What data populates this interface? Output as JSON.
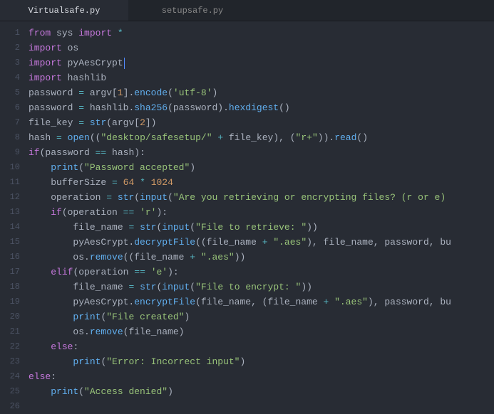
{
  "tabs": {
    "active": "Virtualsafe.py",
    "inactive": "setupsafe.py"
  },
  "editor": {
    "lines": [
      {
        "num": "1",
        "tokens": [
          {
            "c": "kw",
            "t": "from"
          },
          {
            "c": "plain",
            "t": " sys "
          },
          {
            "c": "kw",
            "t": "import"
          },
          {
            "c": "plain",
            "t": " "
          },
          {
            "c": "op",
            "t": "*"
          }
        ]
      },
      {
        "num": "2",
        "tokens": [
          {
            "c": "kw",
            "t": "import"
          },
          {
            "c": "plain",
            "t": " os"
          }
        ]
      },
      {
        "num": "3",
        "tokens": [
          {
            "c": "kw",
            "t": "import"
          },
          {
            "c": "plain",
            "t": " pyAesCrypt"
          }
        ],
        "cursor": true
      },
      {
        "num": "4",
        "tokens": [
          {
            "c": "kw",
            "t": "import"
          },
          {
            "c": "plain",
            "t": " hashlib"
          }
        ]
      },
      {
        "num": "5",
        "tokens": [
          {
            "c": "plain",
            "t": "password "
          },
          {
            "c": "op",
            "t": "="
          },
          {
            "c": "plain",
            "t": " argv["
          },
          {
            "c": "num",
            "t": "1"
          },
          {
            "c": "plain",
            "t": "]."
          },
          {
            "c": "fn",
            "t": "encode"
          },
          {
            "c": "plain",
            "t": "("
          },
          {
            "c": "str",
            "t": "'utf-8'"
          },
          {
            "c": "plain",
            "t": ")"
          }
        ]
      },
      {
        "num": "6",
        "tokens": [
          {
            "c": "plain",
            "t": "password "
          },
          {
            "c": "op",
            "t": "="
          },
          {
            "c": "plain",
            "t": " hashlib."
          },
          {
            "c": "fn",
            "t": "sha256"
          },
          {
            "c": "plain",
            "t": "(password)."
          },
          {
            "c": "fn",
            "t": "hexdigest"
          },
          {
            "c": "plain",
            "t": "()"
          }
        ]
      },
      {
        "num": "7",
        "tokens": [
          {
            "c": "plain",
            "t": "file_key "
          },
          {
            "c": "op",
            "t": "="
          },
          {
            "c": "plain",
            "t": " "
          },
          {
            "c": "fn",
            "t": "str"
          },
          {
            "c": "plain",
            "t": "(argv["
          },
          {
            "c": "num",
            "t": "2"
          },
          {
            "c": "plain",
            "t": "])"
          }
        ]
      },
      {
        "num": "8",
        "tokens": [
          {
            "c": "plain",
            "t": "hash "
          },
          {
            "c": "op",
            "t": "="
          },
          {
            "c": "plain",
            "t": " "
          },
          {
            "c": "fn",
            "t": "open"
          },
          {
            "c": "plain",
            "t": "(("
          },
          {
            "c": "str",
            "t": "\"desktop/safesetup/\""
          },
          {
            "c": "plain",
            "t": " "
          },
          {
            "c": "op",
            "t": "+"
          },
          {
            "c": "plain",
            "t": " file_key), ("
          },
          {
            "c": "str",
            "t": "\"r+\""
          },
          {
            "c": "plain",
            "t": "))."
          },
          {
            "c": "fn",
            "t": "read"
          },
          {
            "c": "plain",
            "t": "()"
          }
        ]
      },
      {
        "num": "9",
        "tokens": [
          {
            "c": "kw",
            "t": "if"
          },
          {
            "c": "plain",
            "t": "(password "
          },
          {
            "c": "op",
            "t": "=="
          },
          {
            "c": "plain",
            "t": " hash):"
          }
        ]
      },
      {
        "num": "10",
        "tokens": [
          {
            "c": "plain",
            "t": "    "
          },
          {
            "c": "fn",
            "t": "print"
          },
          {
            "c": "plain",
            "t": "("
          },
          {
            "c": "str",
            "t": "\"Password accepted\""
          },
          {
            "c": "plain",
            "t": ")"
          }
        ]
      },
      {
        "num": "11",
        "tokens": [
          {
            "c": "plain",
            "t": "    bufferSize "
          },
          {
            "c": "op",
            "t": "="
          },
          {
            "c": "plain",
            "t": " "
          },
          {
            "c": "num",
            "t": "64"
          },
          {
            "c": "plain",
            "t": " "
          },
          {
            "c": "op",
            "t": "*"
          },
          {
            "c": "plain",
            "t": " "
          },
          {
            "c": "num",
            "t": "1024"
          }
        ]
      },
      {
        "num": "12",
        "tokens": [
          {
            "c": "plain",
            "t": "    operation "
          },
          {
            "c": "op",
            "t": "="
          },
          {
            "c": "plain",
            "t": " "
          },
          {
            "c": "fn",
            "t": "str"
          },
          {
            "c": "plain",
            "t": "("
          },
          {
            "c": "fn",
            "t": "input"
          },
          {
            "c": "plain",
            "t": "("
          },
          {
            "c": "str",
            "t": "\"Are you retrieving or encrypting files? (r or e)"
          }
        ]
      },
      {
        "num": "13",
        "tokens": [
          {
            "c": "plain",
            "t": "    "
          },
          {
            "c": "kw",
            "t": "if"
          },
          {
            "c": "plain",
            "t": "(operation "
          },
          {
            "c": "op",
            "t": "=="
          },
          {
            "c": "plain",
            "t": " "
          },
          {
            "c": "str",
            "t": "'r'"
          },
          {
            "c": "plain",
            "t": "):"
          }
        ]
      },
      {
        "num": "14",
        "tokens": [
          {
            "c": "plain",
            "t": "        file_name "
          },
          {
            "c": "op",
            "t": "="
          },
          {
            "c": "plain",
            "t": " "
          },
          {
            "c": "fn",
            "t": "str"
          },
          {
            "c": "plain",
            "t": "("
          },
          {
            "c": "fn",
            "t": "input"
          },
          {
            "c": "plain",
            "t": "("
          },
          {
            "c": "str",
            "t": "\"File to retrieve: \""
          },
          {
            "c": "plain",
            "t": "))"
          }
        ]
      },
      {
        "num": "15",
        "tokens": [
          {
            "c": "plain",
            "t": "        pyAesCrypt."
          },
          {
            "c": "fn",
            "t": "decryptFile"
          },
          {
            "c": "plain",
            "t": "((file_name "
          },
          {
            "c": "op",
            "t": "+"
          },
          {
            "c": "plain",
            "t": " "
          },
          {
            "c": "str",
            "t": "\".aes\""
          },
          {
            "c": "plain",
            "t": "), file_name, password, bu"
          }
        ]
      },
      {
        "num": "16",
        "tokens": [
          {
            "c": "plain",
            "t": "        os."
          },
          {
            "c": "fn",
            "t": "remove"
          },
          {
            "c": "plain",
            "t": "((file_name "
          },
          {
            "c": "op",
            "t": "+"
          },
          {
            "c": "plain",
            "t": " "
          },
          {
            "c": "str",
            "t": "\".aes\""
          },
          {
            "c": "plain",
            "t": "))"
          }
        ]
      },
      {
        "num": "17",
        "tokens": [
          {
            "c": "plain",
            "t": "    "
          },
          {
            "c": "kw",
            "t": "elif"
          },
          {
            "c": "plain",
            "t": "(operation "
          },
          {
            "c": "op",
            "t": "=="
          },
          {
            "c": "plain",
            "t": " "
          },
          {
            "c": "str",
            "t": "'e'"
          },
          {
            "c": "plain",
            "t": "):"
          }
        ]
      },
      {
        "num": "18",
        "tokens": [
          {
            "c": "plain",
            "t": "        file_name "
          },
          {
            "c": "op",
            "t": "="
          },
          {
            "c": "plain",
            "t": " "
          },
          {
            "c": "fn",
            "t": "str"
          },
          {
            "c": "plain",
            "t": "("
          },
          {
            "c": "fn",
            "t": "input"
          },
          {
            "c": "plain",
            "t": "("
          },
          {
            "c": "str",
            "t": "\"File to encrypt: \""
          },
          {
            "c": "plain",
            "t": "))"
          }
        ]
      },
      {
        "num": "19",
        "tokens": [
          {
            "c": "plain",
            "t": "        pyAesCrypt."
          },
          {
            "c": "fn",
            "t": "encryptFile"
          },
          {
            "c": "plain",
            "t": "(file_name, (file_name "
          },
          {
            "c": "op",
            "t": "+"
          },
          {
            "c": "plain",
            "t": " "
          },
          {
            "c": "str",
            "t": "\".aes\""
          },
          {
            "c": "plain",
            "t": "), password, bu"
          }
        ]
      },
      {
        "num": "20",
        "tokens": [
          {
            "c": "plain",
            "t": "        "
          },
          {
            "c": "fn",
            "t": "print"
          },
          {
            "c": "plain",
            "t": "("
          },
          {
            "c": "str",
            "t": "\"File created\""
          },
          {
            "c": "plain",
            "t": ")"
          }
        ]
      },
      {
        "num": "21",
        "tokens": [
          {
            "c": "plain",
            "t": "        os."
          },
          {
            "c": "fn",
            "t": "remove"
          },
          {
            "c": "plain",
            "t": "(file_name)"
          }
        ]
      },
      {
        "num": "22",
        "tokens": [
          {
            "c": "plain",
            "t": "    "
          },
          {
            "c": "kw",
            "t": "else"
          },
          {
            "c": "plain",
            "t": ":"
          }
        ]
      },
      {
        "num": "23",
        "tokens": [
          {
            "c": "plain",
            "t": "        "
          },
          {
            "c": "fn",
            "t": "print"
          },
          {
            "c": "plain",
            "t": "("
          },
          {
            "c": "str",
            "t": "\"Error: Incorrect input\""
          },
          {
            "c": "plain",
            "t": ")"
          }
        ]
      },
      {
        "num": "24",
        "tokens": [
          {
            "c": "kw",
            "t": "else"
          },
          {
            "c": "plain",
            "t": ":"
          }
        ]
      },
      {
        "num": "25",
        "tokens": [
          {
            "c": "plain",
            "t": "    "
          },
          {
            "c": "fn",
            "t": "print"
          },
          {
            "c": "plain",
            "t": "("
          },
          {
            "c": "str",
            "t": "\"Access denied\""
          },
          {
            "c": "plain",
            "t": ")"
          }
        ]
      },
      {
        "num": "26",
        "tokens": []
      }
    ]
  }
}
